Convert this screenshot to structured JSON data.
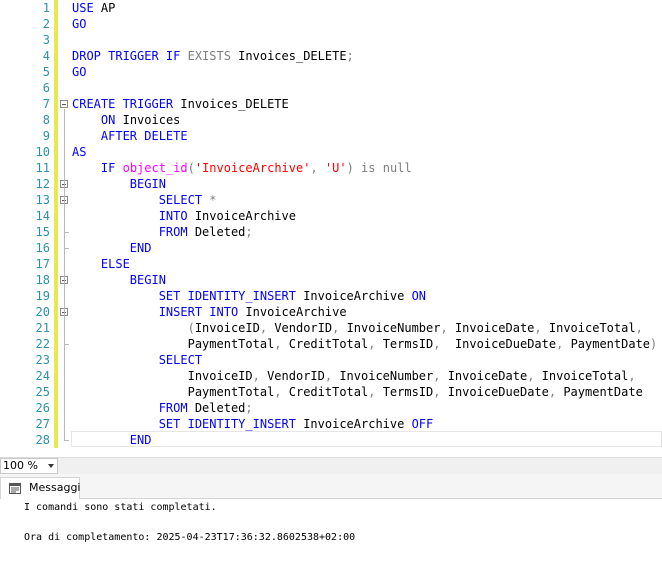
{
  "editor": {
    "line_numbers": [
      "1",
      "2",
      "3",
      "4",
      "5",
      "6",
      "7",
      "8",
      "9",
      "10",
      "11",
      "12",
      "13",
      "14",
      "15",
      "16",
      "17",
      "18",
      "19",
      "20",
      "21",
      "22",
      "23",
      "24",
      "25",
      "26",
      "27",
      "28"
    ],
    "lines": [
      [
        {
          "t": "USE ",
          "k": "kw"
        },
        {
          "t": "AP",
          "k": ""
        }
      ],
      [
        {
          "t": "GO",
          "k": "kw"
        }
      ],
      [],
      [
        {
          "t": "DROP TRIGGER IF ",
          "k": "kw"
        },
        {
          "t": "EXISTS ",
          "k": "gr"
        },
        {
          "t": "Invoices_DELETE",
          "k": ""
        },
        {
          "t": ";",
          "k": "gr"
        }
      ],
      [
        {
          "t": "GO",
          "k": "kw"
        }
      ],
      [],
      [
        {
          "t": "CREATE TRIGGER ",
          "k": "kw"
        },
        {
          "t": "Invoices_DELETE",
          "k": ""
        }
      ],
      [
        {
          "t": "    ",
          "k": ""
        },
        {
          "t": "ON ",
          "k": "kw"
        },
        {
          "t": "Invoices",
          "k": ""
        }
      ],
      [
        {
          "t": "    ",
          "k": ""
        },
        {
          "t": "AFTER DELETE",
          "k": "kw"
        }
      ],
      [
        {
          "t": "AS",
          "k": "kw"
        }
      ],
      [
        {
          "t": "    ",
          "k": ""
        },
        {
          "t": "IF ",
          "k": "kw"
        },
        {
          "t": "object_id",
          "k": "fn"
        },
        {
          "t": "(",
          "k": "gr"
        },
        {
          "t": "'InvoiceArchive'",
          "k": "str"
        },
        {
          "t": ", ",
          "k": "gr"
        },
        {
          "t": "'U'",
          "k": "str"
        },
        {
          "t": ") ",
          "k": "gr"
        },
        {
          "t": "is null",
          "k": "gr"
        }
      ],
      [
        {
          "t": "        ",
          "k": ""
        },
        {
          "t": "BEGIN",
          "k": "kw"
        }
      ],
      [
        {
          "t": "            ",
          "k": ""
        },
        {
          "t": "SELECT ",
          "k": "kw"
        },
        {
          "t": "*",
          "k": "gr"
        }
      ],
      [
        {
          "t": "            ",
          "k": ""
        },
        {
          "t": "INTO ",
          "k": "kw"
        },
        {
          "t": "InvoiceArchive",
          "k": ""
        }
      ],
      [
        {
          "t": "            ",
          "k": ""
        },
        {
          "t": "FROM ",
          "k": "kw"
        },
        {
          "t": "Deleted",
          "k": ""
        },
        {
          "t": ";",
          "k": "gr"
        }
      ],
      [
        {
          "t": "        ",
          "k": ""
        },
        {
          "t": "END",
          "k": "kw"
        }
      ],
      [
        {
          "t": "    ",
          "k": ""
        },
        {
          "t": "ELSE",
          "k": "kw"
        }
      ],
      [
        {
          "t": "        ",
          "k": ""
        },
        {
          "t": "BEGIN",
          "k": "kw"
        }
      ],
      [
        {
          "t": "            ",
          "k": ""
        },
        {
          "t": "SET IDENTITY_INSERT ",
          "k": "kw"
        },
        {
          "t": "InvoiceArchive ",
          "k": ""
        },
        {
          "t": "ON",
          "k": "kw"
        }
      ],
      [
        {
          "t": "            ",
          "k": ""
        },
        {
          "t": "INSERT INTO ",
          "k": "kw"
        },
        {
          "t": "InvoiceArchive",
          "k": ""
        }
      ],
      [
        {
          "t": "                ",
          "k": ""
        },
        {
          "t": "(",
          "k": "gr"
        },
        {
          "t": "InvoiceID",
          "k": ""
        },
        {
          "t": ", ",
          "k": "gr"
        },
        {
          "t": "VendorID",
          "k": ""
        },
        {
          "t": ", ",
          "k": "gr"
        },
        {
          "t": "InvoiceNumber",
          "k": ""
        },
        {
          "t": ", ",
          "k": "gr"
        },
        {
          "t": "InvoiceDate",
          "k": ""
        },
        {
          "t": ", ",
          "k": "gr"
        },
        {
          "t": "InvoiceTotal",
          "k": ""
        },
        {
          "t": ",",
          "k": "gr"
        }
      ],
      [
        {
          "t": "                ",
          "k": ""
        },
        {
          "t": "PaymentTotal",
          "k": ""
        },
        {
          "t": ", ",
          "k": "gr"
        },
        {
          "t": "CreditTotal",
          "k": ""
        },
        {
          "t": ", ",
          "k": "gr"
        },
        {
          "t": "TermsID",
          "k": ""
        },
        {
          "t": ",  ",
          "k": "gr"
        },
        {
          "t": "InvoiceDueDate",
          "k": ""
        },
        {
          "t": ", ",
          "k": "gr"
        },
        {
          "t": "PaymentDate",
          "k": ""
        },
        {
          "t": ")",
          "k": "gr"
        }
      ],
      [
        {
          "t": "            ",
          "k": ""
        },
        {
          "t": "SELECT",
          "k": "kw"
        }
      ],
      [
        {
          "t": "                ",
          "k": ""
        },
        {
          "t": "InvoiceID",
          "k": ""
        },
        {
          "t": ", ",
          "k": "gr"
        },
        {
          "t": "VendorID",
          "k": ""
        },
        {
          "t": ", ",
          "k": "gr"
        },
        {
          "t": "InvoiceNumber",
          "k": ""
        },
        {
          "t": ", ",
          "k": "gr"
        },
        {
          "t": "InvoiceDate",
          "k": ""
        },
        {
          "t": ", ",
          "k": "gr"
        },
        {
          "t": "InvoiceTotal",
          "k": ""
        },
        {
          "t": ",",
          "k": "gr"
        }
      ],
      [
        {
          "t": "                ",
          "k": ""
        },
        {
          "t": "PaymentTotal",
          "k": ""
        },
        {
          "t": ", ",
          "k": "gr"
        },
        {
          "t": "CreditTotal",
          "k": ""
        },
        {
          "t": ", ",
          "k": "gr"
        },
        {
          "t": "TermsID",
          "k": ""
        },
        {
          "t": ", ",
          "k": "gr"
        },
        {
          "t": "InvoiceDueDate",
          "k": ""
        },
        {
          "t": ", ",
          "k": "gr"
        },
        {
          "t": "PaymentDate",
          "k": ""
        }
      ],
      [
        {
          "t": "            ",
          "k": ""
        },
        {
          "t": "FROM ",
          "k": "kw"
        },
        {
          "t": "Deleted",
          "k": ""
        },
        {
          "t": ";",
          "k": "gr"
        }
      ],
      [
        {
          "t": "            ",
          "k": ""
        },
        {
          "t": "SET IDENTITY_INSERT ",
          "k": "kw"
        },
        {
          "t": "InvoiceArchive ",
          "k": ""
        },
        {
          "t": "OFF",
          "k": "kw"
        }
      ],
      [
        {
          "t": "        ",
          "k": ""
        },
        {
          "t": "END",
          "k": "kw"
        }
      ]
    ],
    "fold_lines": [
      7,
      12,
      13,
      18,
      20
    ]
  },
  "status": {
    "zoom": "100 %"
  },
  "results": {
    "tab_label": "Messaggi",
    "messages": [
      "I comandi sono stati completati.",
      "",
      "Ora di completamento: 2025-04-23T17:36:32.8602538+02:00"
    ]
  },
  "colors": {
    "keyword": "#0000ff",
    "operator": "#808080",
    "function": "#ff00ff",
    "string": "#ff0000",
    "line_number": "#2b91af",
    "change_bar": "#e8e84f"
  }
}
